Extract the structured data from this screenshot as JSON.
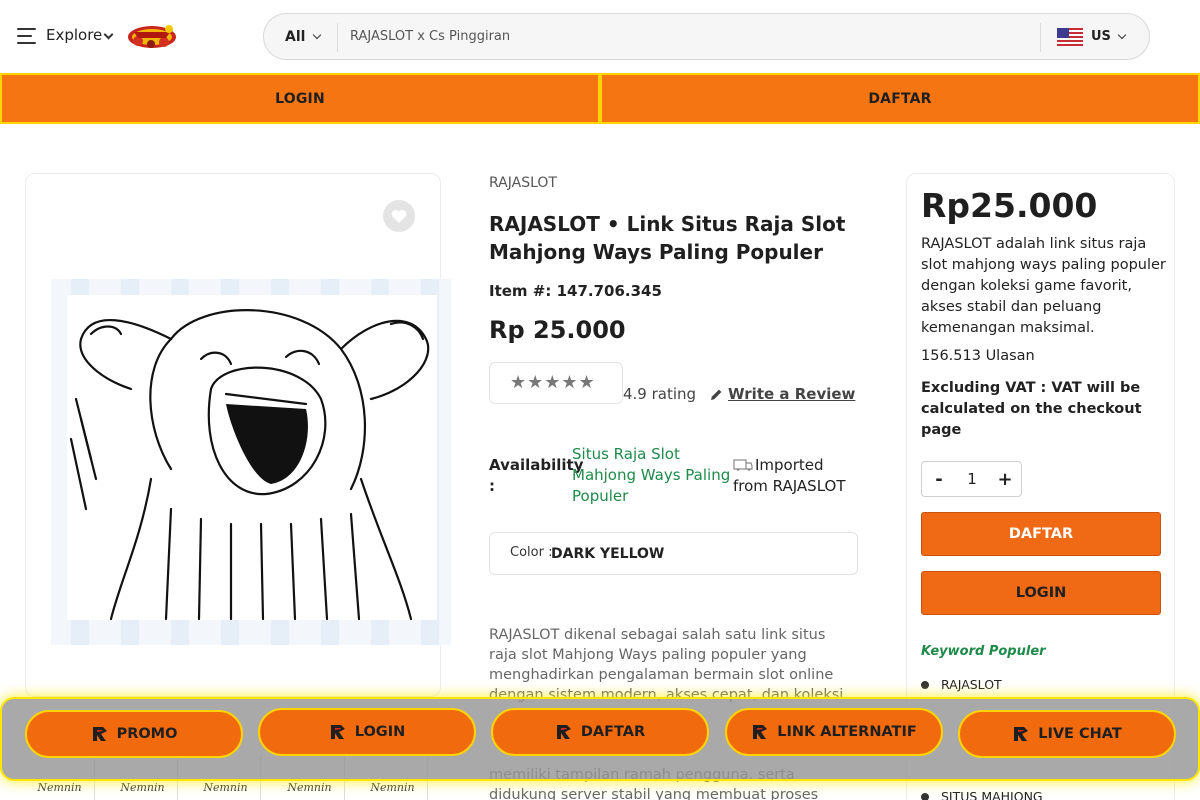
{
  "header": {
    "explore_label": "Explore",
    "search": {
      "category": "All",
      "value": "RAJASLOT x Cs Pinggiran"
    },
    "locale": "US"
  },
  "auth_bar": {
    "login_label": "LOGIN",
    "register_label": "DAFTAR"
  },
  "product": {
    "brand": "RAJASLOT",
    "title": "RAJASLOT • Link Situs Raja Slot Mahjong Ways Paling Populer",
    "item_number": "Item #: 147.706.345",
    "price": "Rp 25.000",
    "stars": "★★★★★",
    "rating": "4.9 rating",
    "write_review": "Write a Review",
    "availability_label": "Availability :",
    "availability_value": "Situs Raja Slot Mahjong Ways Paling Populer",
    "imported_from": "Imported from RAJASLOT",
    "color_label": "Color :",
    "color_value": "DARK YELLOW",
    "description": "RAJASLOT dikenal sebagai salah satu link situs raja slot Mahjong Ways paling populer yang menghadirkan pengalaman bermain slot online dengan sistem modern, akses cepat, dan koleksi",
    "description_more": "memiliki tampilan ramah pengguna, serta didukung server stabil yang membuat proses bermain",
    "thumbnails": [
      "Nemnin",
      "Nemnin",
      "Nemnin",
      "Nemnin",
      "Nemnin"
    ]
  },
  "panel": {
    "price": "Rp25.000",
    "description": "RAJASLOT adalah link situs raja slot mahjong ways paling populer dengan koleksi game favorit, akses stabil dan peluang kemenangan maksimal.",
    "reviews": "156.513 Ulasan",
    "vat_note": "Excluding VAT : VAT will be calculated on the checkout page",
    "quantity": "1",
    "qty_minus": "-",
    "qty_plus": "+",
    "register_label": "DAFTAR",
    "login_label": "LOGIN",
    "keywords_title": "Keyword Populer",
    "keywords": [
      "RAJASLOT",
      "SITUS MAHJONG"
    ]
  },
  "float_bar": {
    "buttons": [
      "PROMO",
      "LOGIN",
      "DAFTAR",
      "LINK ALTERNATIF",
      "LIVE CHAT"
    ]
  },
  "colors": {
    "orange": "#f47512",
    "border_yellow": "#ffd400",
    "green": "#1e8a4a"
  },
  "icons": [
    "menu-icon",
    "chevron-down-icon",
    "logo",
    "us-flag-icon",
    "heart-icon",
    "star-icon",
    "pencil-icon",
    "import-icon",
    "r-brand-icon"
  ]
}
